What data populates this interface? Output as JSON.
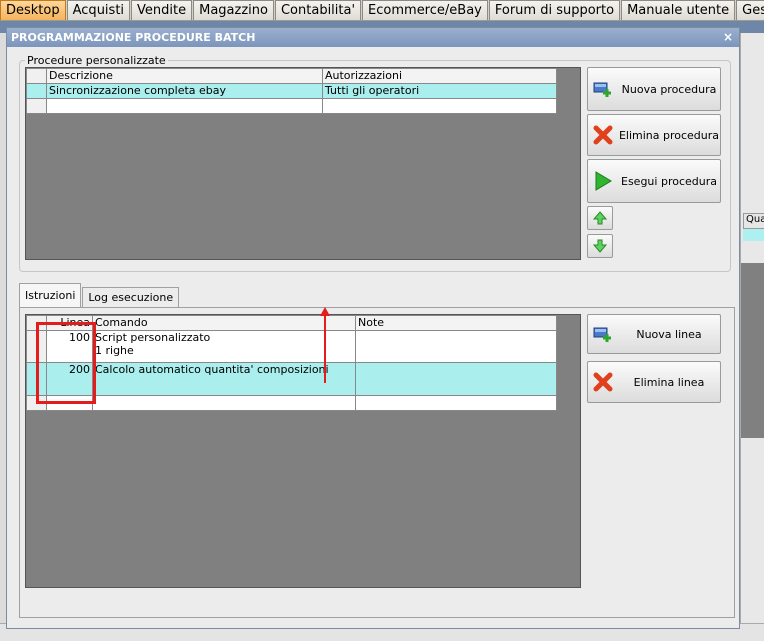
{
  "top_tabs": [
    "Desktop",
    "Acquisti",
    "Vendite",
    "Magazzino",
    "Contabilita'",
    "Ecommerce/eBay",
    "Forum di supporto",
    "Manuale utente",
    "Gest"
  ],
  "background": {
    "col_header": "Qua"
  },
  "dialog": {
    "title": "PROGRAMMAZIONE PROCEDURE BATCH",
    "close": "×",
    "group_label": "Procedure personalizzate",
    "procedures": {
      "headers": [
        "Descrizione",
        "Autorizzazioni"
      ],
      "rows": [
        [
          "Sincronizzazione completa ebay",
          "Tutti gli operatori"
        ]
      ]
    },
    "buttons": {
      "new_procedure": "Nuova procedura",
      "delete_procedure": "Elimina procedura",
      "run_procedure": "Esegui procedura",
      "new_line": "Nuova linea",
      "delete_line": "Elimina linea"
    },
    "tabs": [
      "Istruzioni",
      "Log esecuzione"
    ],
    "instructions": {
      "headers": [
        "Linea",
        "Comando",
        "Note"
      ],
      "rows": [
        {
          "line": "100",
          "command_1": "Script personalizzato",
          "command_2": "1 righe",
          "note": ""
        },
        {
          "line": "200",
          "command_1": "Calcolo automatico quantita' composizioni",
          "command_2": "",
          "note": ""
        }
      ]
    }
  },
  "colors": {
    "selected_row": "#aaeeed",
    "highlight": "#e51c1c",
    "active_tab": "#f5b35a"
  }
}
